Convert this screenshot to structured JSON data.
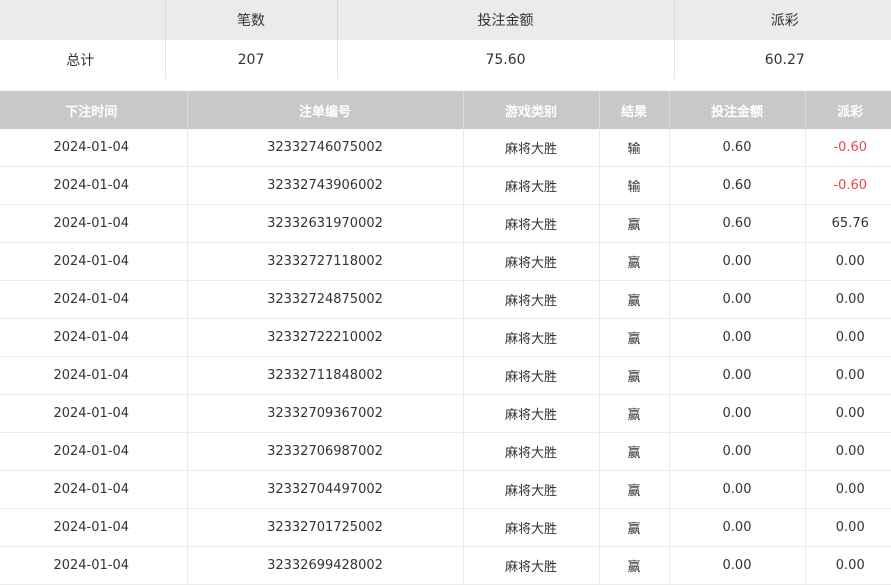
{
  "summary": {
    "headers": [
      "",
      "笔数",
      "投注金额",
      "派彩"
    ],
    "label": "总计",
    "count": "207",
    "bet_total": "75.60",
    "payout_total": "60.27"
  },
  "detail": {
    "headers": {
      "time": "下注时间",
      "order_id": "注单编号",
      "game_type": "游戏类别",
      "result": "结果",
      "bet_amount": "投注金额",
      "payout": "派彩"
    },
    "rows": [
      {
        "time": "2024-01-04",
        "order_id": "32332746075002",
        "game_type": "麻将大胜",
        "result": "输",
        "bet_amount": "0.60",
        "payout": "-0.60"
      },
      {
        "time": "2024-01-04",
        "order_id": "32332743906002",
        "game_type": "麻将大胜",
        "result": "输",
        "bet_amount": "0.60",
        "payout": "-0.60"
      },
      {
        "time": "2024-01-04",
        "order_id": "32332631970002",
        "game_type": "麻将大胜",
        "result": "赢",
        "bet_amount": "0.60",
        "payout": "65.76"
      },
      {
        "time": "2024-01-04",
        "order_id": "32332727118002",
        "game_type": "麻将大胜",
        "result": "赢",
        "bet_amount": "0.00",
        "payout": "0.00"
      },
      {
        "time": "2024-01-04",
        "order_id": "32332724875002",
        "game_type": "麻将大胜",
        "result": "赢",
        "bet_amount": "0.00",
        "payout": "0.00"
      },
      {
        "time": "2024-01-04",
        "order_id": "32332722210002",
        "game_type": "麻将大胜",
        "result": "赢",
        "bet_amount": "0.00",
        "payout": "0.00"
      },
      {
        "time": "2024-01-04",
        "order_id": "32332711848002",
        "game_type": "麻将大胜",
        "result": "赢",
        "bet_amount": "0.00",
        "payout": "0.00"
      },
      {
        "time": "2024-01-04",
        "order_id": "32332709367002",
        "game_type": "麻将大胜",
        "result": "赢",
        "bet_amount": "0.00",
        "payout": "0.00"
      },
      {
        "time": "2024-01-04",
        "order_id": "32332706987002",
        "game_type": "麻将大胜",
        "result": "赢",
        "bet_amount": "0.00",
        "payout": "0.00"
      },
      {
        "time": "2024-01-04",
        "order_id": "32332704497002",
        "game_type": "麻将大胜",
        "result": "赢",
        "bet_amount": "0.00",
        "payout": "0.00"
      },
      {
        "time": "2024-01-04",
        "order_id": "32332701725002",
        "game_type": "麻将大胜",
        "result": "赢",
        "bet_amount": "0.00",
        "payout": "0.00"
      },
      {
        "time": "2024-01-04",
        "order_id": "32332699428002",
        "game_type": "麻将大胜",
        "result": "赢",
        "bet_amount": "0.00",
        "payout": "0.00"
      }
    ]
  },
  "colors": {
    "negative_payout": "#e84a4a",
    "detail_header_bg": "#c8c8c8",
    "summary_header_bg": "#ebebeb"
  }
}
